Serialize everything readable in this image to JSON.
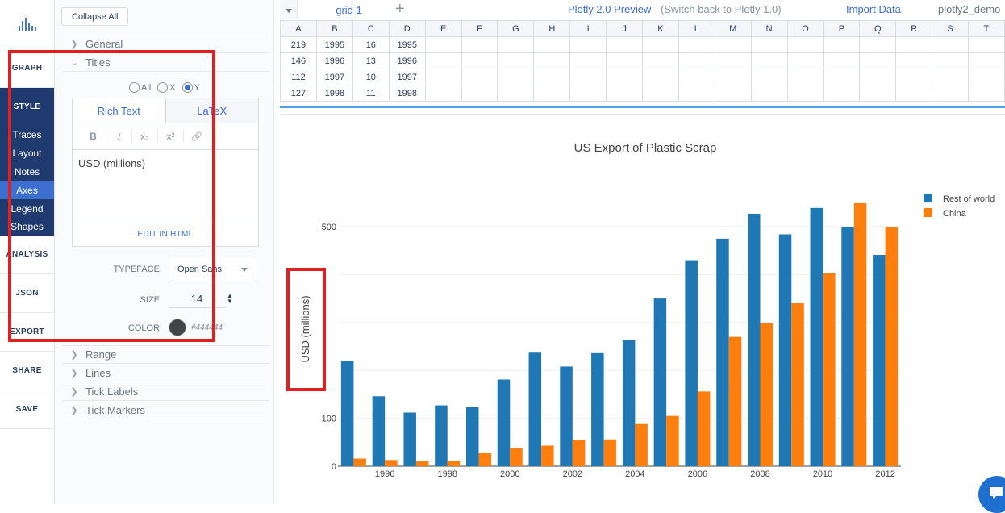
{
  "nav": {
    "graph": "GRAPH",
    "style": "STYLE",
    "style_items": [
      "Traces",
      "Layout",
      "Notes",
      "Axes",
      "Legend",
      "Shapes"
    ],
    "analysis": "ANALYSIS",
    "json": "JSON",
    "export": "EXPORT",
    "share": "SHARE",
    "save": "SAVE"
  },
  "panel": {
    "collapse_all": "Collapse All",
    "sections": {
      "general": "General",
      "titles": "Titles",
      "range": "Range",
      "lines": "Lines",
      "tick_labels": "Tick Labels",
      "tick_markers": "Tick Markers"
    },
    "axis_options": [
      "All",
      "X",
      "Y"
    ],
    "selected_axis": "Y",
    "editor_tabs": [
      "Rich Text",
      "LaTeX"
    ],
    "editor_toolbar": [
      "B",
      "I",
      "x₂",
      "x²",
      "🔗"
    ],
    "title_text": "USD (millions)",
    "edit_in_html": "EDIT IN HTML",
    "typeface_label": "TYPEFACE",
    "typeface_value": "Open Sans",
    "size_label": "SIZE",
    "size_value": "14",
    "color_label": "COLOR",
    "color_value": "#444444"
  },
  "topbar": {
    "grid_tab": "grid 1",
    "preview": "Plotly 2.0 Preview",
    "switch_back": "(Switch back to Plotly 1.0)",
    "import_data": "Import Data",
    "user": "plotly2_demo"
  },
  "grid": {
    "columns": [
      "A",
      "B",
      "C",
      "D",
      "E",
      "F",
      "G",
      "H",
      "I",
      "J",
      "K",
      "L",
      "M",
      "N",
      "O",
      "P",
      "Q",
      "R",
      "S",
      "T"
    ],
    "rows": [
      [
        "219",
        "1995",
        "16",
        "1995"
      ],
      [
        "146",
        "1996",
        "13",
        "1996"
      ],
      [
        "112",
        "1997",
        "10",
        "1997"
      ],
      [
        "127",
        "1998",
        "11",
        "1998"
      ]
    ]
  },
  "chart_data": {
    "type": "bar",
    "title": "US Export of Plastic Scrap",
    "ylabel": "USD (millions)",
    "categories": [
      1995,
      1996,
      1997,
      1998,
      1999,
      2000,
      2001,
      2002,
      2003,
      2004,
      2005,
      2006,
      2007,
      2008,
      2009,
      2010,
      2011,
      2012
    ],
    "x_ticks": [
      "1996",
      "1998",
      "2000",
      "2002",
      "2004",
      "2006",
      "2008",
      "2010",
      "2012"
    ],
    "y_ticks": [
      "0",
      "100",
      "",
      "",
      "",
      "500"
    ],
    "ylim": [
      0,
      560
    ],
    "legend_position": "top-right",
    "series": [
      {
        "name": "Rest of world",
        "color": "#1f77b4",
        "values": [
          219,
          146,
          112,
          127,
          124,
          181,
          237,
          208,
          236,
          263,
          350,
          430,
          475,
          527,
          484,
          539,
          500,
          441
        ]
      },
      {
        "name": "China",
        "color": "#ff7f0e",
        "values": [
          16,
          13,
          10,
          11,
          28,
          37,
          43,
          55,
          56,
          88,
          105,
          156,
          270,
          299,
          340,
          403,
          549,
          499
        ]
      }
    ]
  }
}
